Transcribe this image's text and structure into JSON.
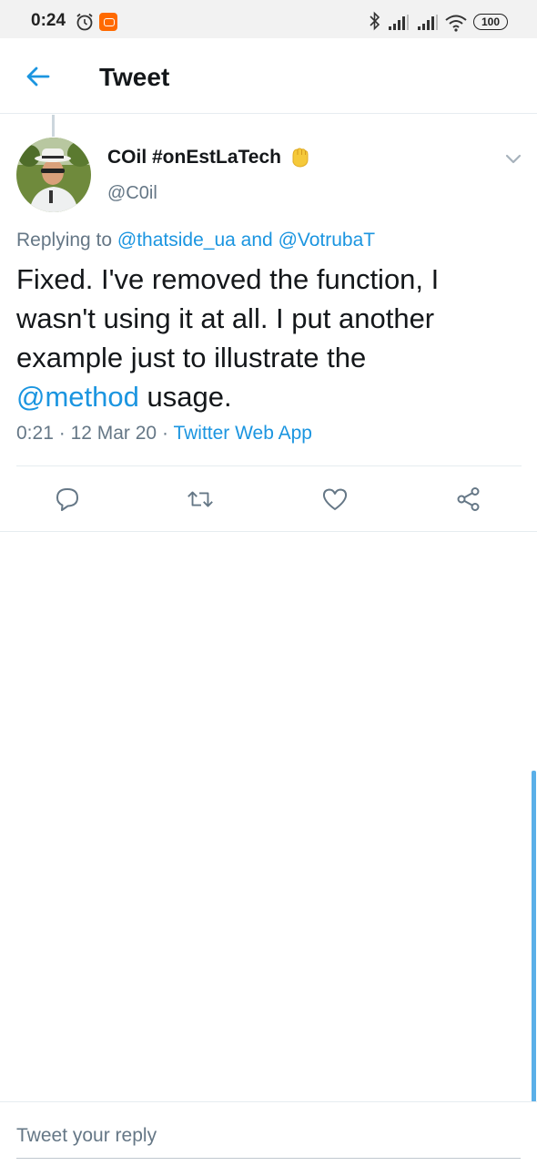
{
  "status_bar": {
    "time": "0:24",
    "battery": "100",
    "icons": [
      "alarm-icon",
      "app-badge-icon",
      "bluetooth-icon",
      "signal-icon",
      "signal-icon",
      "wifi-icon",
      "battery-icon"
    ]
  },
  "header": {
    "title": "Tweet",
    "back_icon": "arrow-left-icon"
  },
  "tweet": {
    "author": {
      "display_name": "COil #onEstLaTech",
      "emoji": "raised-fist-emoji",
      "handle": "@C0il"
    },
    "reply_context": {
      "prefix": "Replying to",
      "mention_1": "@thatside_ua",
      "conjunction": "and",
      "mention_2": "@VotrubaT"
    },
    "text": {
      "line_1": "Fixed. I've removed the function, I",
      "line_2": "wasn't using it at all. I put another",
      "line_3": "example just to illustrate the",
      "mention": "@method",
      "line_4_rest": " usage."
    },
    "meta": {
      "time": "0:21",
      "separator": "·",
      "date": "12 Mar 20",
      "source": "Twitter Web App"
    },
    "actions": [
      "reply-icon",
      "retweet-icon",
      "like-icon",
      "share-icon"
    ]
  },
  "reply_bar": {
    "placeholder": "Tweet your reply"
  },
  "colors": {
    "accent": "#1b95e0",
    "secondary_text": "#657786",
    "primary_text": "#14171a",
    "divider": "#e6ecf0"
  }
}
